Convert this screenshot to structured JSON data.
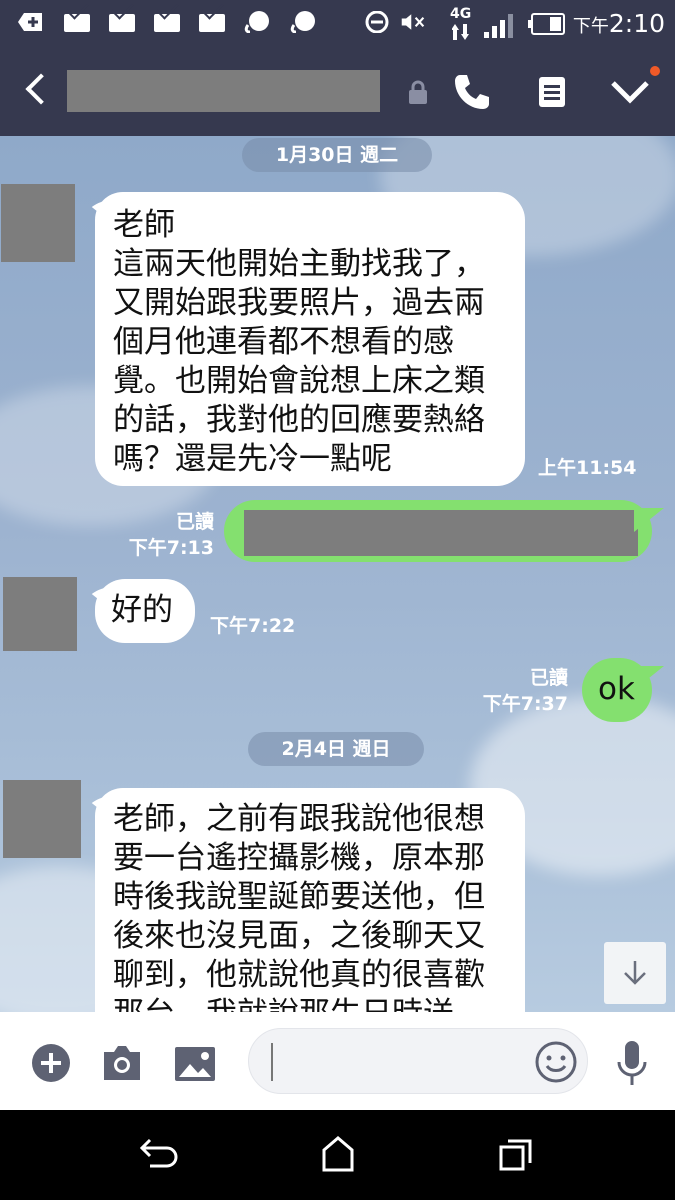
{
  "status_bar": {
    "network": "4G",
    "time_prefix": "下午",
    "time": "2:10"
  },
  "header": {
    "title": ""
  },
  "messages": {
    "date_1": "1月30日 週二",
    "m1_text": "老師\n這兩天他開始主動找我了，\n又開始跟我要照片，過去兩\n個月他連看都不想看的感\n覺。也開始會說想上床之類\n的話，我對他的回應要熱絡\n嗎？還是先冷一點呢",
    "m1_time": "上午11:54",
    "m2_read": "已讀",
    "m2_time": "下午7:13",
    "m3_text": "好的",
    "m3_time": "下午7:22",
    "m4_read": "已讀",
    "m4_time": "下午7:37",
    "m4_text": "ok",
    "date_2": "2月4日 週日",
    "m5_text": "老師，之前有跟我說他很想\n要一台遙控攝影機，原本那\n時後我說聖誕節要送他，但\n後來也沒見面，之後聊天又\n聊到，他就說他真的很喜歡\n那台，我就說那生日時送"
  },
  "input": {
    "value": ""
  },
  "colors": {
    "header_bg": "#36394f",
    "sent_bubble": "#84e06f",
    "received_bubble": "#ffffff"
  }
}
